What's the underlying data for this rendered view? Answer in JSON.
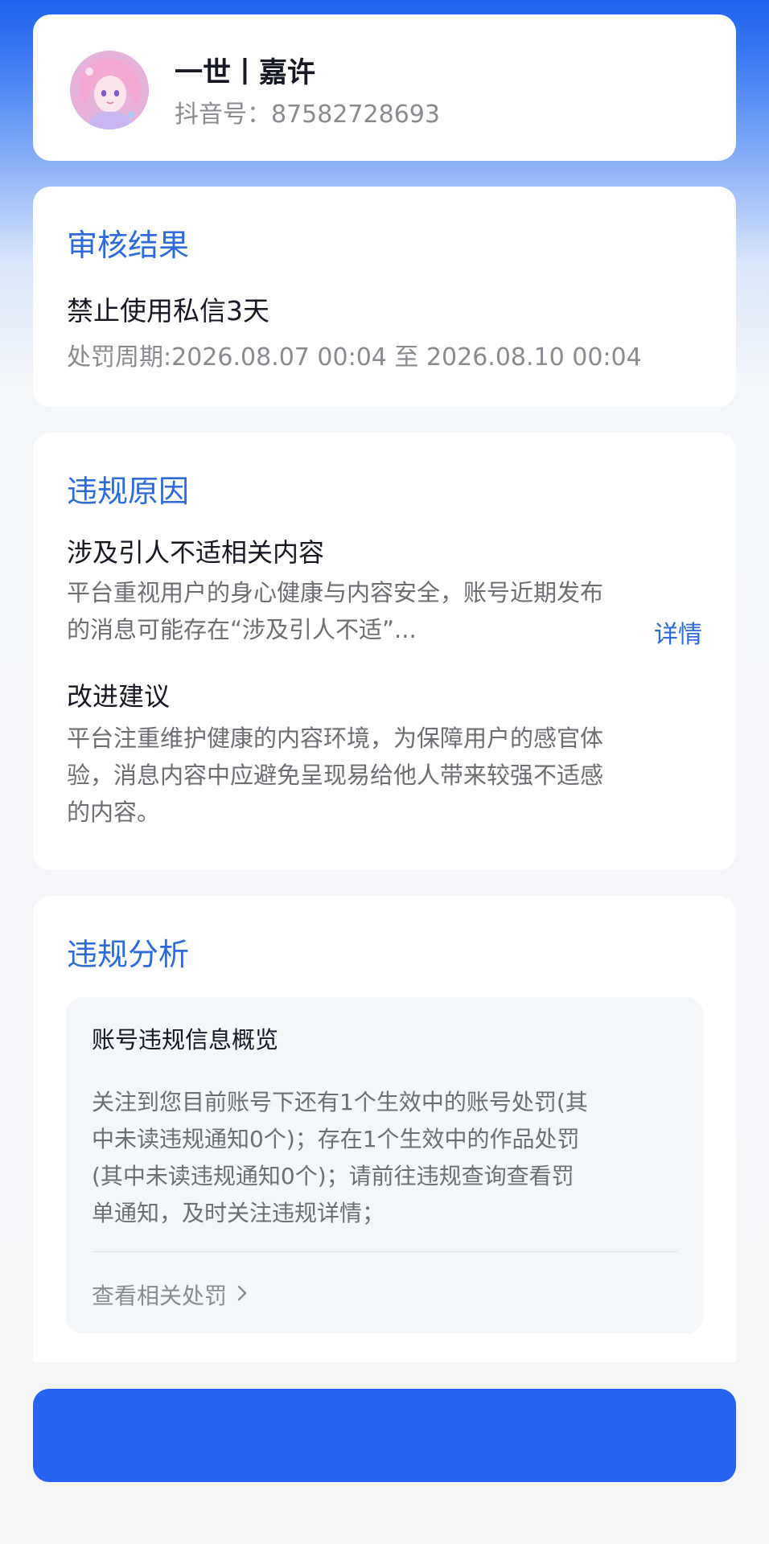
{
  "profile": {
    "name": "一世丨嘉许",
    "douyin_id": "抖音号：87582728693",
    "avatar_icon": "anime-avatar"
  },
  "result": {
    "title": "审核结果",
    "penalty": "禁止使用私信3天",
    "period": "处罚周期:2026.08.07 00:04 至 2026.08.10 00:04"
  },
  "reason": {
    "title": "违规原因",
    "heading": "涉及引人不适相关内容",
    "description_lines": [
      "平台重视用户的身心健康与内容安全，账号近期发布",
      "的消息可能存在“涉及引人不适”..."
    ],
    "detail_label": "详情",
    "advice_heading": "改进建议",
    "advice_lines": [
      "平台注重维护健康的内容环境，为保障用户的感官体",
      "验，消息内容中应避免呈现易给他人带来较强不适感",
      "的内容。"
    ]
  },
  "analysis": {
    "title": "违规分析",
    "overview_title": "账号违规信息概览",
    "overview_lines": [
      "关注到您目前账号下还有1个生效中的账号处罚(其",
      "中未读违规通知0个)；存在1个生效中的作品处罚",
      "(其中未读违规通知0个)；请前往违规查询查看罚",
      "单通知，及时关注违规详情；"
    ],
    "related_label": "查看相关处罚",
    "chevron_icon": "chevron-right-icon"
  },
  "bottom_button": {
    "label": ""
  },
  "colors": {
    "accent": "#2d6bdb",
    "button": "#2563f0",
    "header_gradient_top": "#1f62ee",
    "background": "#f5f6f8"
  }
}
